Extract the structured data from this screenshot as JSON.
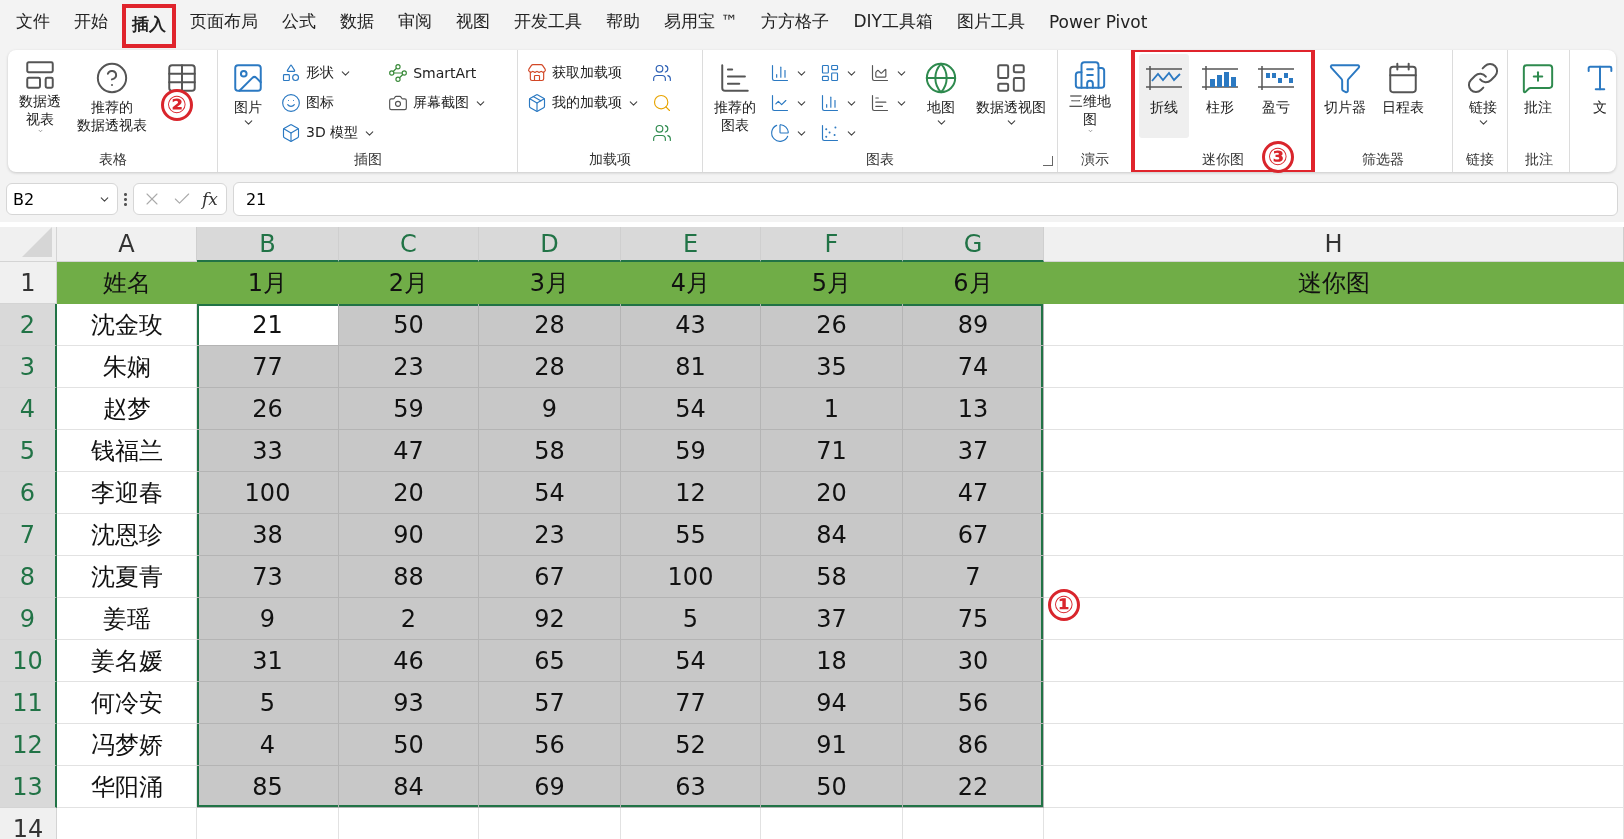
{
  "menu_tabs": [
    {
      "label": "文件",
      "selected": false,
      "highlighted": false
    },
    {
      "label": "开始",
      "selected": false,
      "highlighted": false
    },
    {
      "label": "插入",
      "selected": true,
      "highlighted": true
    },
    {
      "label": "页面布局",
      "selected": false,
      "highlighted": false
    },
    {
      "label": "公式",
      "selected": false,
      "highlighted": false
    },
    {
      "label": "数据",
      "selected": false,
      "highlighted": false
    },
    {
      "label": "审阅",
      "selected": false,
      "highlighted": false
    },
    {
      "label": "视图",
      "selected": false,
      "highlighted": false
    },
    {
      "label": "开发工具",
      "selected": false,
      "highlighted": false
    },
    {
      "label": "帮助",
      "selected": false,
      "highlighted": false
    },
    {
      "label": "易用宝 ™",
      "selected": false,
      "highlighted": false
    },
    {
      "label": "方方格子",
      "selected": false,
      "highlighted": false
    },
    {
      "label": "DIY工具箱",
      "selected": false,
      "highlighted": false
    },
    {
      "label": "图片工具",
      "selected": false,
      "highlighted": false
    },
    {
      "label": "Power Pivot",
      "selected": false,
      "highlighted": false
    }
  ],
  "ribbon_groups": [
    {
      "label": "表格",
      "highlighted": false,
      "launcher": false,
      "items": [
        {
          "kind": "large",
          "label_lines": [
            "数据透",
            "视表"
          ],
          "dropdown": true,
          "hovered": false
        },
        {
          "kind": "large",
          "label_lines": [
            "推荐的",
            "数据透视表"
          ],
          "dropdown": false,
          "hovered": false
        },
        {
          "kind": "large",
          "hovered": false
        }
      ]
    },
    {
      "label": "插图",
      "highlighted": false,
      "launcher": false,
      "items": [
        {
          "kind": "large",
          "label": "图片",
          "dropdown": true,
          "hovered": false
        },
        {
          "kind": "stack",
          "children": [
            {
              "label": "形状",
              "dropdown": true
            },
            {
              "label": "图标",
              "dropdown": false
            },
            {
              "label": "3D 模型",
              "dropdown": true
            }
          ]
        },
        {
          "kind": "stack",
          "children": [
            {
              "label": "SmartArt",
              "dropdown": false
            },
            {
              "label": "屏幕截图",
              "dropdown": true
            }
          ]
        }
      ]
    },
    {
      "label": "加载项",
      "highlighted": false,
      "launcher": false,
      "items": [
        {
          "kind": "stack",
          "children": [
            {
              "label": "获取加载项",
              "dropdown": false
            },
            {
              "label": "我的加载项",
              "dropdown": true
            }
          ]
        },
        {
          "kind": "icons",
          "children": [
            {
              "dropdown": false
            },
            {
              "dropdown": false
            },
            {
              "dropdown": false
            }
          ]
        }
      ]
    },
    {
      "label": "图表",
      "highlighted": false,
      "launcher": true,
      "items": [
        {
          "kind": "large",
          "label_lines": [
            "推荐的",
            "图表"
          ],
          "dropdown": false,
          "hovered": false
        },
        {
          "kind": "icons",
          "children": [
            {
              "dropdown": true
            },
            {
              "dropdown": true
            },
            {
              "dropdown": true
            }
          ]
        },
        {
          "kind": "icons",
          "children": [
            {
              "dropdown": true
            },
            {
              "dropdown": true
            },
            {
              "dropdown": true
            }
          ]
        },
        {
          "kind": "icons",
          "children": [
            {
              "dropdown": true
            },
            {
              "dropdown": true
            }
          ]
        },
        {
          "kind": "large",
          "label": "地图",
          "dropdown": true,
          "hovered": false
        },
        {
          "kind": "large",
          "label": "数据透视图",
          "dropdown": true,
          "hovered": false
        }
      ]
    },
    {
      "label": "演示",
      "highlighted": false,
      "launcher": false,
      "items": [
        {
          "kind": "large",
          "label_lines": [
            "三维地",
            "图"
          ],
          "dropdown": true,
          "hovered": false
        }
      ]
    },
    {
      "label": "迷你图",
      "highlighted": true,
      "launcher": false,
      "items": [
        {
          "kind": "large",
          "label": "折线",
          "dropdown": false,
          "hovered": true
        },
        {
          "kind": "large",
          "label": "柱形",
          "dropdown": false,
          "hovered": false
        },
        {
          "kind": "large",
          "label": "盈亏",
          "dropdown": false,
          "hovered": false
        }
      ]
    },
    {
      "label": "筛选器",
      "highlighted": false,
      "launcher": false,
      "items": [
        {
          "kind": "large",
          "label": "切片器",
          "dropdown": false,
          "hovered": false
        },
        {
          "kind": "large",
          "label": "日程表",
          "dropdown": false,
          "hovered": false
        }
      ]
    },
    {
      "label": "链接",
      "highlighted": false,
      "launcher": false,
      "items": [
        {
          "kind": "large",
          "label": "链接",
          "dropdown": true,
          "hovered": false
        }
      ]
    },
    {
      "label": "批注",
      "highlighted": false,
      "launcher": false,
      "items": [
        {
          "kind": "large",
          "label": "批注",
          "dropdown": false,
          "hovered": false
        }
      ]
    },
    {
      "highlighted": false,
      "items": [
        {
          "kind": "large",
          "label": "文",
          "hovered": false
        }
      ]
    }
  ],
  "formula_bar": {
    "name_box": "B2",
    "formula": "21",
    "fx": "fx"
  },
  "sheet": {
    "columns": [
      {
        "label": "A",
        "selected": false
      },
      {
        "label": "B",
        "selected": true
      },
      {
        "label": "C",
        "selected": true
      },
      {
        "label": "D",
        "selected": true
      },
      {
        "label": "E",
        "selected": true
      },
      {
        "label": "F",
        "selected": true
      },
      {
        "label": "G",
        "selected": true
      },
      {
        "label": "H",
        "selected": false
      }
    ],
    "rows": [
      {
        "number": "1",
        "kind": "header",
        "selected": false,
        "cells": [
          "姓名",
          "1月",
          "2月",
          "3月",
          "4月",
          "5月",
          "6月",
          "迷你图"
        ]
      },
      {
        "number": "2",
        "kind": "data",
        "selected": true,
        "active": true,
        "cells": [
          "沈金玫",
          "21",
          "50",
          "28",
          "43",
          "26",
          "89"
        ]
      },
      {
        "number": "3",
        "kind": "data",
        "selected": true,
        "active": false,
        "cells": [
          "朱娴",
          "77",
          "23",
          "28",
          "81",
          "35",
          "74"
        ]
      },
      {
        "number": "4",
        "kind": "data",
        "selected": true,
        "active": false,
        "cells": [
          "赵梦",
          "26",
          "59",
          "9",
          "54",
          "1",
          "13"
        ]
      },
      {
        "number": "5",
        "kind": "data",
        "selected": true,
        "active": false,
        "cells": [
          "钱福兰",
          "33",
          "47",
          "58",
          "59",
          "71",
          "37"
        ]
      },
      {
        "number": "6",
        "kind": "data",
        "selected": true,
        "active": false,
        "cells": [
          "李迎春",
          "100",
          "20",
          "54",
          "12",
          "20",
          "47"
        ]
      },
      {
        "number": "7",
        "kind": "data",
        "selected": true,
        "active": false,
        "cells": [
          "沈恩珍",
          "38",
          "90",
          "23",
          "55",
          "84",
          "67"
        ]
      },
      {
        "number": "8",
        "kind": "data",
        "selected": true,
        "active": false,
        "cells": [
          "沈夏青",
          "73",
          "88",
          "67",
          "100",
          "58",
          "7"
        ]
      },
      {
        "number": "9",
        "kind": "data",
        "selected": true,
        "active": false,
        "cells": [
          "姜瑶",
          "9",
          "2",
          "92",
          "5",
          "37",
          "75"
        ]
      },
      {
        "number": "10",
        "kind": "data",
        "selected": true,
        "active": false,
        "cells": [
          "姜名媛",
          "31",
          "46",
          "65",
          "54",
          "18",
          "30"
        ]
      },
      {
        "number": "11",
        "kind": "data",
        "selected": true,
        "active": false,
        "cells": [
          "何冷安",
          "5",
          "93",
          "57",
          "77",
          "94",
          "56"
        ]
      },
      {
        "number": "12",
        "kind": "data",
        "selected": true,
        "active": false,
        "cells": [
          "冯梦娇",
          "4",
          "50",
          "56",
          "52",
          "91",
          "86"
        ]
      },
      {
        "number": "13",
        "kind": "data",
        "selected": true,
        "active": false,
        "cells": [
          "华阳涌",
          "85",
          "84",
          "69",
          "63",
          "50",
          "22"
        ]
      },
      {
        "number": "14",
        "kind": "data",
        "selected": false,
        "cells": []
      }
    ]
  },
  "callouts": [
    {
      "label": "①"
    },
    {
      "label": "②"
    },
    {
      "label": "③"
    }
  ]
}
